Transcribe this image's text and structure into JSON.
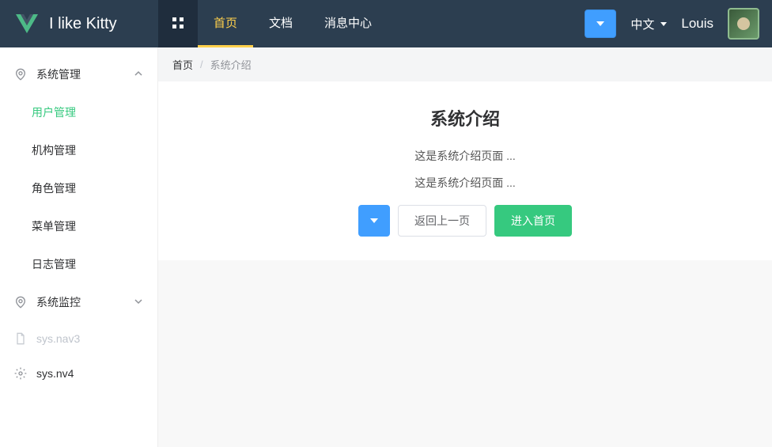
{
  "header": {
    "logo_text": "I like Kitty",
    "tabs": [
      {
        "label": "首页",
        "active": true
      },
      {
        "label": "文档",
        "active": false
      },
      {
        "label": "消息中心",
        "active": false
      }
    ],
    "language_label": "中文",
    "username": "Louis"
  },
  "sidebar": {
    "groups": [
      {
        "title": "系统管理",
        "icon": "location-icon",
        "expanded": true,
        "disabled": false,
        "items": [
          {
            "label": "用户管理",
            "active": true
          },
          {
            "label": "机构管理",
            "active": false
          },
          {
            "label": "角色管理",
            "active": false
          },
          {
            "label": "菜单管理",
            "active": false
          },
          {
            "label": "日志管理",
            "active": false
          }
        ]
      },
      {
        "title": "系统监控",
        "icon": "location-icon",
        "expanded": false,
        "disabled": false,
        "items": []
      },
      {
        "title": "sys.nav3",
        "icon": "document-icon",
        "expanded": false,
        "disabled": true,
        "items": []
      },
      {
        "title": "sys.nv4",
        "icon": "settings-icon",
        "expanded": false,
        "disabled": false,
        "items": []
      }
    ]
  },
  "breadcrumb": {
    "items": [
      {
        "label": "首页",
        "current": false
      },
      {
        "label": "系统介绍",
        "current": true
      }
    ]
  },
  "content": {
    "title": "系统介绍",
    "line1": "这是系统介绍页面 ...",
    "line2": "这是系统介绍页面 ...",
    "back_label": "返回上一页",
    "home_label": "进入首页"
  }
}
